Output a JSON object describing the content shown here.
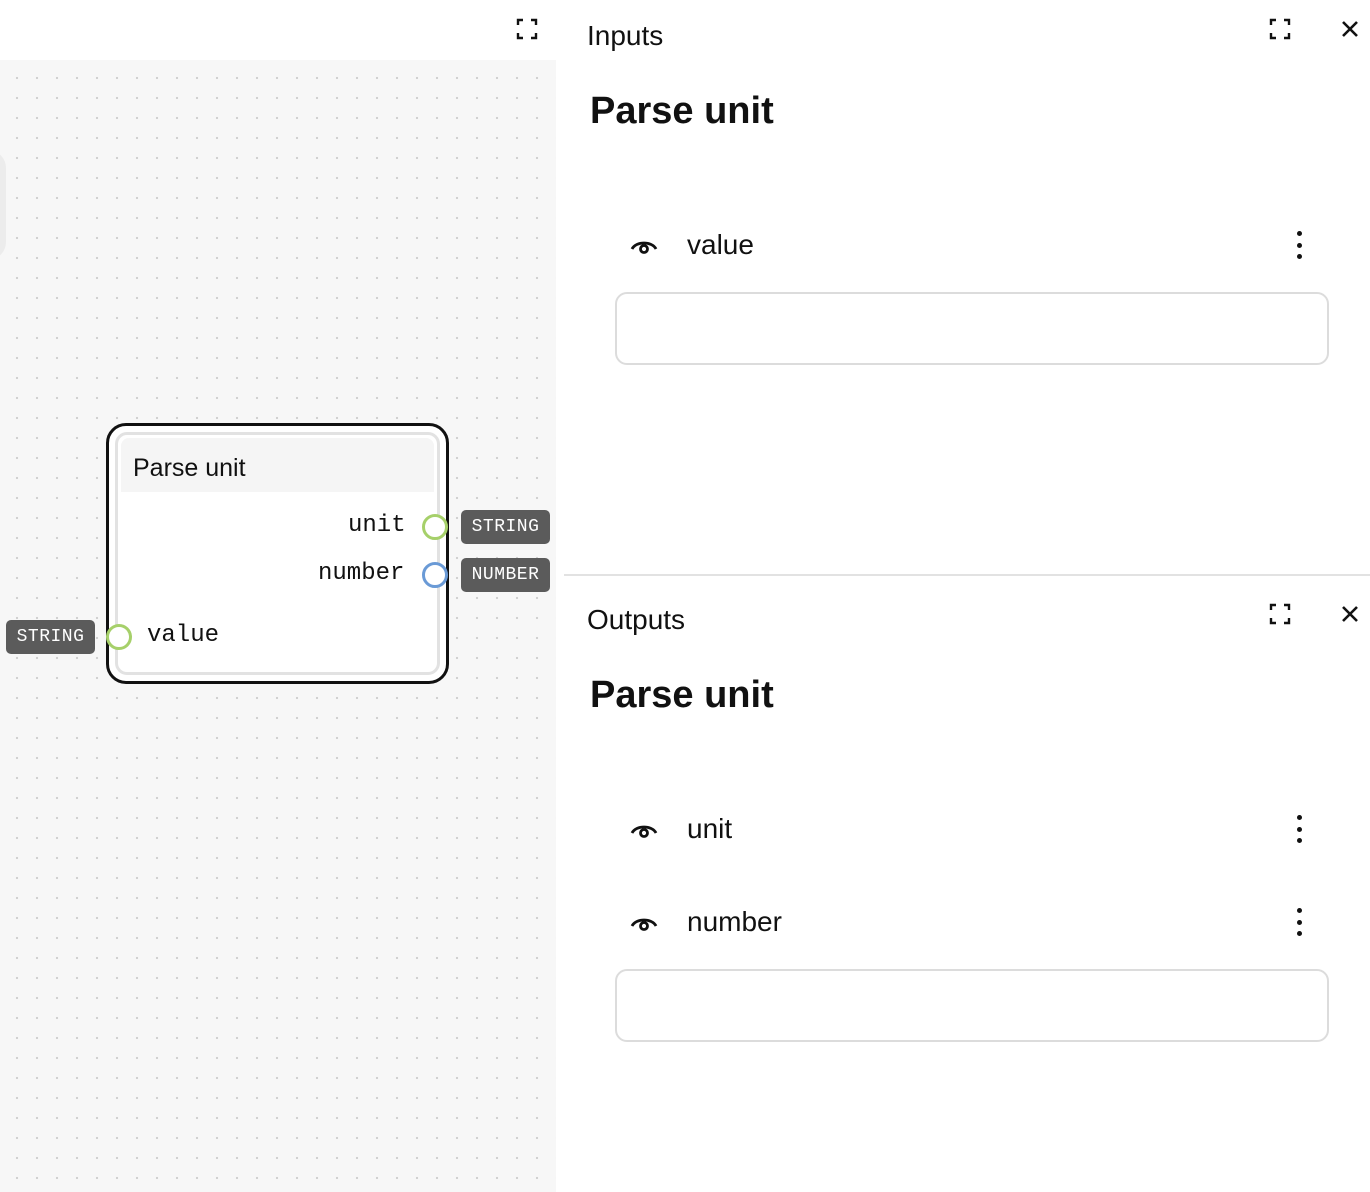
{
  "canvas": {
    "node": {
      "title": "Parse unit",
      "outputs": [
        {
          "label": "unit",
          "type": "STRING"
        },
        {
          "label": "number",
          "type": "NUMBER"
        }
      ],
      "inputs": [
        {
          "label": "value",
          "type": "STRING"
        }
      ]
    }
  },
  "inputs_panel": {
    "title": "Inputs",
    "heading": "Parse unit",
    "fields": [
      {
        "label": "value"
      }
    ],
    "text_value": ""
  },
  "outputs_panel": {
    "title": "Outputs",
    "heading": "Parse unit",
    "fields": [
      {
        "label": "unit"
      },
      {
        "label": "number"
      }
    ],
    "text_value": ""
  },
  "colors": {
    "string_port": "#a6d06a",
    "number_port": "#6a9ad6",
    "badge": "#5b5b5b"
  },
  "icons": [
    "expand-icon",
    "close-icon",
    "eye-icon",
    "kebab-menu-icon"
  ]
}
